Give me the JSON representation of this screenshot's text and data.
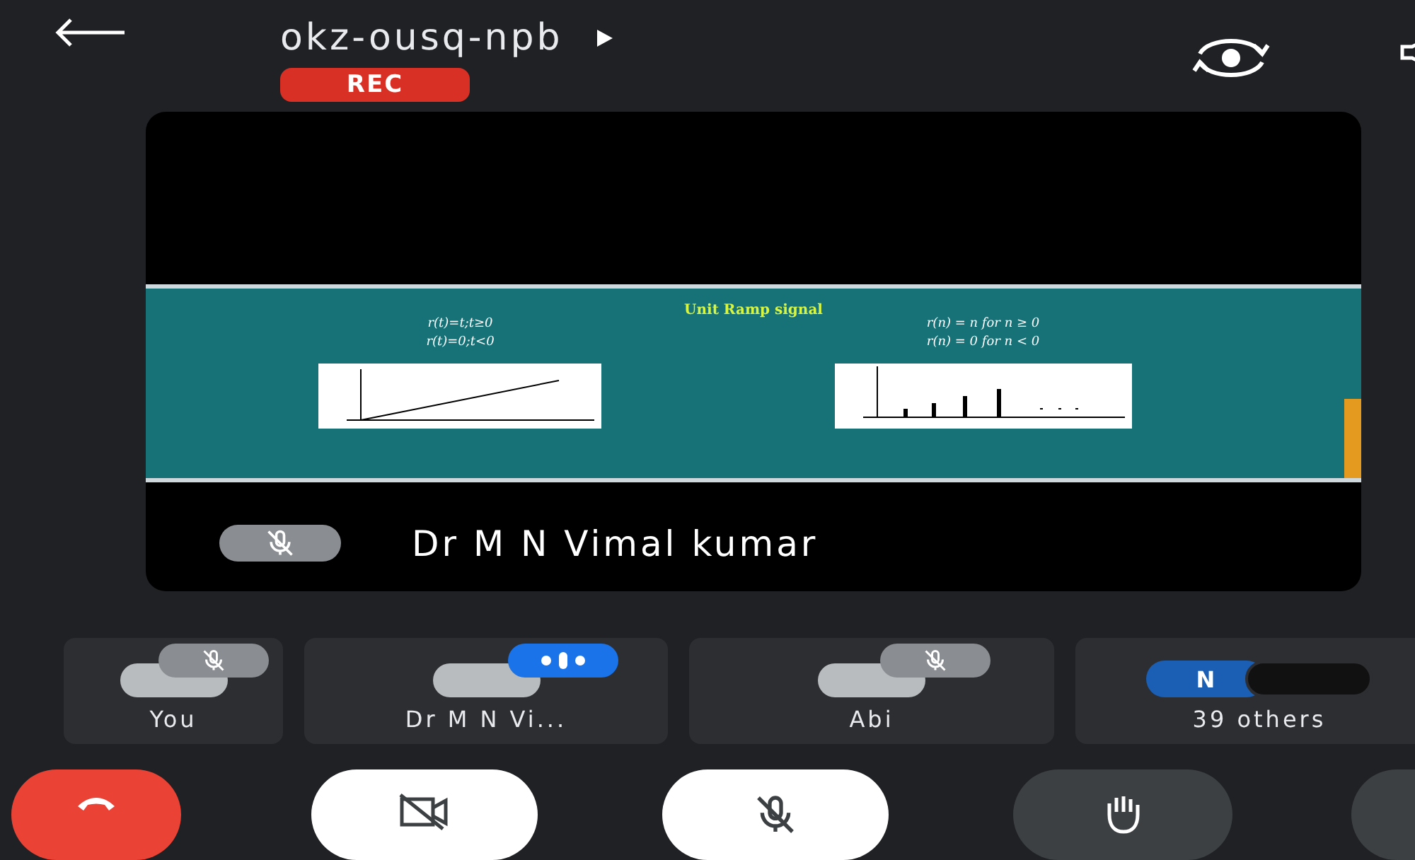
{
  "header": {
    "meeting_code": "okz-ousq-npb",
    "recording_badge": "REC"
  },
  "main_tile": {
    "speaker_name": "Dr M N Vimal kumar",
    "muted": true,
    "slide": {
      "title": "Unit Ramp signal",
      "left_formulas": [
        "r(t)=t;t≥0",
        "r(t)=0;t<0"
      ],
      "right_formulas": [
        "r(n) = n for n ≥ 0",
        "r(n) = 0 for n < 0"
      ]
    }
  },
  "participants": [
    {
      "kind": "person",
      "name": "You",
      "muted": true,
      "speaking": false
    },
    {
      "kind": "person",
      "name": "Dr M N Vi...",
      "muted": false,
      "speaking": true
    },
    {
      "kind": "person",
      "name": "Abi",
      "muted": true,
      "speaking": false
    },
    {
      "kind": "group",
      "name": "39 others",
      "initial": "N"
    }
  ],
  "controls": [
    {
      "kind": "end-call"
    },
    {
      "kind": "camera",
      "on": false
    },
    {
      "kind": "mic",
      "on": false
    },
    {
      "kind": "hand",
      "on": false
    },
    {
      "kind": "more"
    }
  ]
}
